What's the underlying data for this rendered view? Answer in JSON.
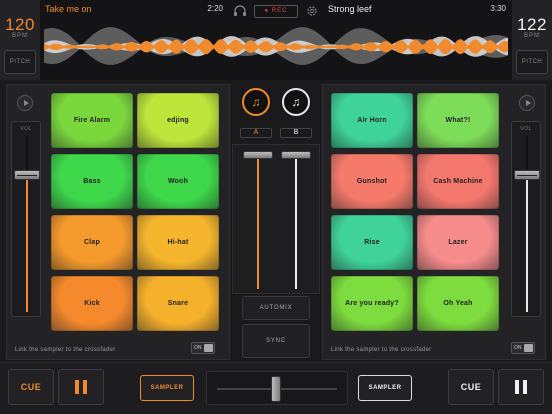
{
  "deck_a": {
    "bpm": "120",
    "bpm_unit": "BPM",
    "pitch_label": "PITCH",
    "track_title": "Take me on",
    "track_time": "2:20",
    "vol_label": "VOL",
    "volume_level": 0.78,
    "footer": "Link the sampler to the crossfader",
    "toggle": "ON",
    "pads": [
      {
        "label": "Fire Alarm",
        "color": "#7ad83c"
      },
      {
        "label": "edjing",
        "color": "#bde53a"
      },
      {
        "label": "Bass",
        "color": "#3ed84a"
      },
      {
        "label": "Wooh",
        "color": "#3ed84a"
      },
      {
        "label": "Clap",
        "color": "#f59a2c"
      },
      {
        "label": "Hi-hat",
        "color": "#f5b52c"
      },
      {
        "label": "Kick",
        "color": "#f58a2c"
      },
      {
        "label": "Snare",
        "color": "#f5b02c"
      }
    ]
  },
  "deck_b": {
    "bpm": "122",
    "bpm_unit": "BPM",
    "pitch_label": "PITCH",
    "track_title": "Strong leef",
    "track_time": "3:30",
    "vol_label": "VOL",
    "volume_level": 0.78,
    "footer": "Link the sampler to the crossfader",
    "toggle": "ON",
    "pads": [
      {
        "label": "Air Horn",
        "color": "#3fd39a"
      },
      {
        "label": "What?!",
        "color": "#7ddc58"
      },
      {
        "label": "Gunshot",
        "color": "#f57a6a"
      },
      {
        "label": "Cash Machine",
        "color": "#f5786e"
      },
      {
        "label": "Rise",
        "color": "#3fd39a"
      },
      {
        "label": "Lazer",
        "color": "#f78c8c"
      },
      {
        "label": "Are you ready?",
        "color": "#7ddc3e"
      },
      {
        "label": "Oh Yeah",
        "color": "#7ddc3e"
      }
    ]
  },
  "header": {
    "rec_label": "● REC",
    "headphone_icon": "headphone-icon",
    "settings_icon": "gear-icon"
  },
  "mixer": {
    "deck_a_tag": "A",
    "deck_b_tag": "B",
    "deck_a_icon": "music-note-icon",
    "deck_b_icon": "music-note-icon",
    "automix_label": "AUTOMIX",
    "sync_label": "SYNC"
  },
  "bottom": {
    "cue_a": "CUE",
    "cue_b": "CUE",
    "sampler_a": "SAMPLER",
    "sampler_b": "SAMPLER",
    "crossfader_position": 0.5
  },
  "colors": {
    "accent": "#f08a2c",
    "deck_b_accent": "#f0f0f0",
    "background": "#1a1a1c"
  }
}
